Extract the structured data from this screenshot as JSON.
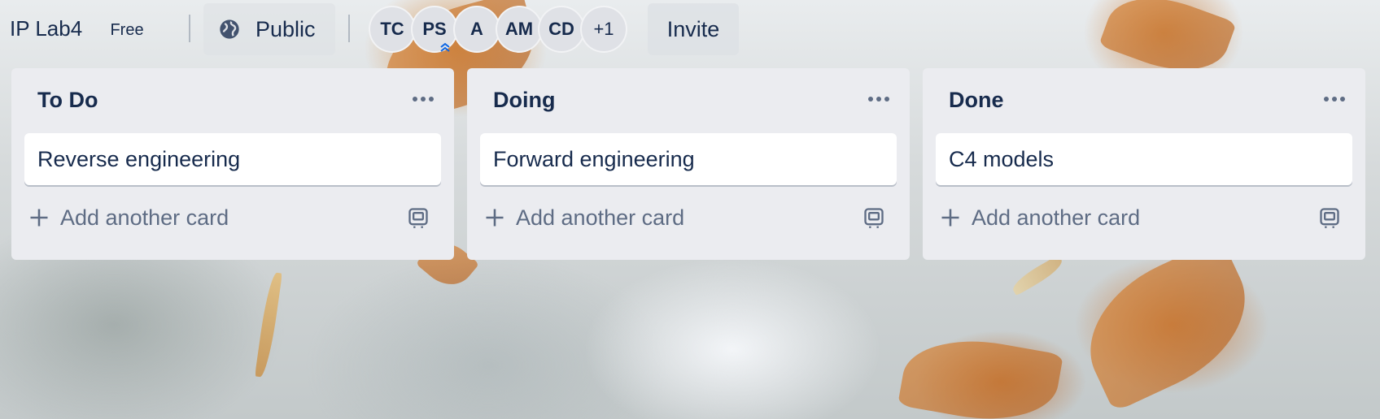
{
  "board": {
    "title": "IP Lab4",
    "plan": "Free",
    "visibility": "Public",
    "invite_label": "Invite"
  },
  "members": [
    "TC",
    "PS",
    "A",
    "AM",
    "CD"
  ],
  "members_more": "+1",
  "lists": [
    {
      "title": "To Do",
      "cards": [
        "Reverse engineering"
      ],
      "add_label": "Add another card"
    },
    {
      "title": "Doing",
      "cards": [
        "Forward engineering"
      ],
      "add_label": "Add another card"
    },
    {
      "title": "Done",
      "cards": [
        "C4 models"
      ],
      "add_label": "Add another card"
    }
  ],
  "colors": {
    "text": "#172b4d",
    "muted": "#5e6c84",
    "list_bg": "#ebecf0",
    "card_bg": "#ffffff"
  },
  "icons": {
    "visibility": "globe-icon",
    "list_menu": "more-horizontal-icon",
    "add": "plus-icon",
    "template": "card-template-icon",
    "admin": "chevron-up-double-icon"
  }
}
